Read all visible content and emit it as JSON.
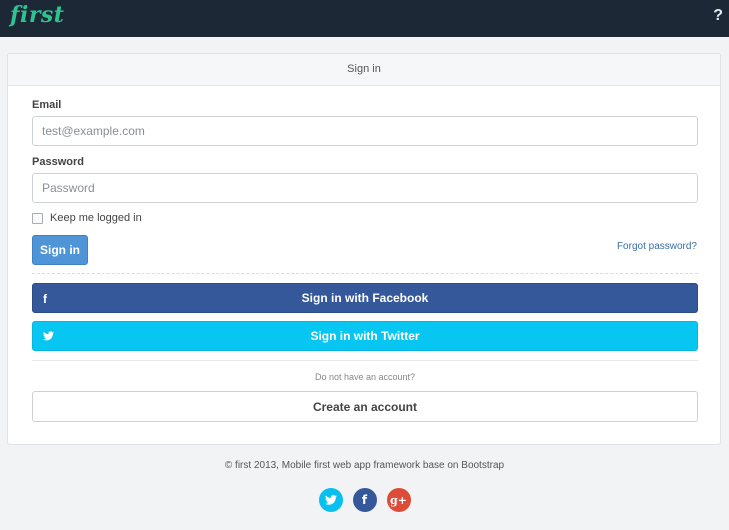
{
  "header": {
    "brand": "first",
    "help_glyph": "?"
  },
  "panel": {
    "title": "Sign in",
    "email_label": "Email",
    "email_placeholder": "test@example.com",
    "email_value": "",
    "password_label": "Password",
    "password_placeholder": "Password",
    "password_value": "",
    "remember_label": "Keep me logged in",
    "remember_checked": false,
    "signin_label": "Sign in",
    "forgot_label": "Forgot password?",
    "facebook_label": "Sign in with Facebook",
    "twitter_label": "Sign in with Twitter",
    "no_account_text": "Do not have an account?",
    "create_account_label": "Create an account"
  },
  "icons": {
    "facebook_glyph": "f",
    "twitter_glyph": "🐦",
    "google_glyph": "g+"
  },
  "footer": {
    "text": "© first 2013, Mobile first web app framework base on Bootstrap"
  },
  "colors": {
    "navbar": "#1c2836",
    "brand": "#2ec48f",
    "primary": "#4f94d6",
    "facebook": "#34589a",
    "twitter": "#08c6f2",
    "google": "#dd4b39"
  }
}
